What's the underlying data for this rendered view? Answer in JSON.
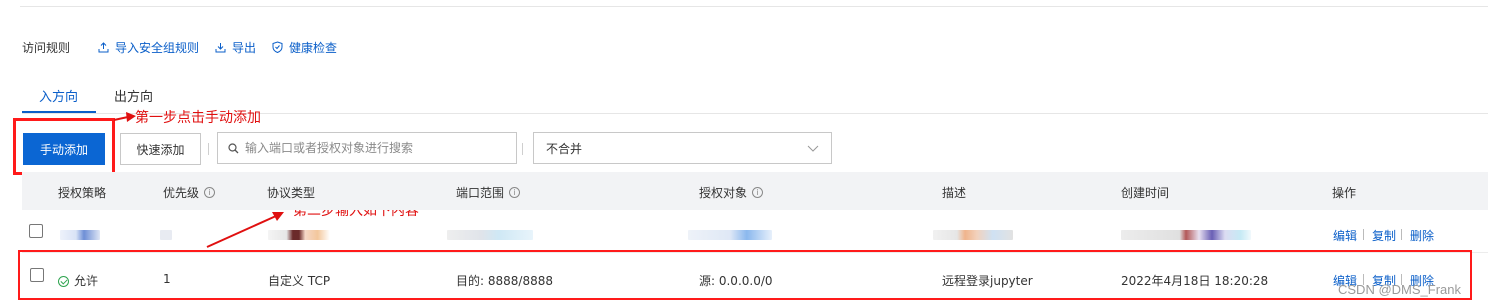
{
  "toolbar": {
    "title": "访问规则",
    "import_label": "导入安全组规则",
    "export_label": "导出",
    "health_label": "健康检查"
  },
  "tabs": [
    {
      "label": "入方向",
      "active": true
    },
    {
      "label": "出方向",
      "active": false
    }
  ],
  "actions": {
    "manual_add": "手动添加",
    "quick_add": "快速添加",
    "search_placeholder": "输入端口或者授权对象进行搜索",
    "merge_select": "不合并"
  },
  "annotations": {
    "step1": "第一步点击手动添加",
    "step2": "第二步输入如下内容"
  },
  "table": {
    "headers": [
      "授权策略",
      "优先级",
      "协议类型",
      "端口范围",
      "授权对象",
      "描述",
      "创建时间",
      "操作"
    ],
    "header_info": [
      false,
      true,
      false,
      true,
      true,
      false,
      false,
      false
    ],
    "row": {
      "policy": "允许",
      "priority": "1",
      "protocol": "自定义 TCP",
      "port": "目的: 8888/8888",
      "source": "源: 0.0.0.0/0",
      "desc": "远程登录jupyter",
      "created": "2022年4月18日 18:20:28"
    },
    "ops": [
      "编辑",
      "复制",
      "删除"
    ]
  },
  "watermark": "CSDN @DMS_Frank",
  "colors": {
    "accent": "#0b66d3",
    "link": "#0b5fc9",
    "annotation": "#ff1a1a",
    "allow": "#2ea44f"
  }
}
